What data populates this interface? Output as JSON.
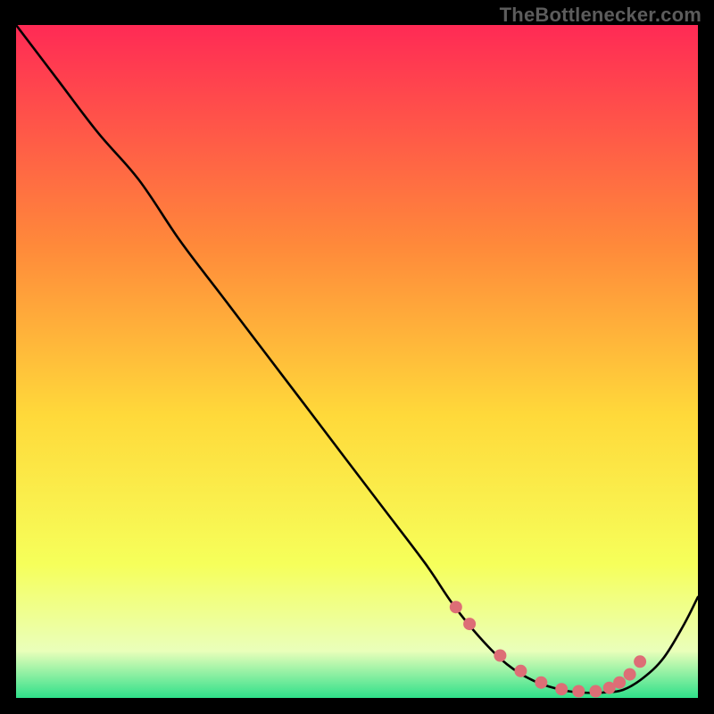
{
  "attribution": "TheBottlenecker.com",
  "colors": {
    "bg_black": "#000000",
    "line": "#000000",
    "dot_fill": "#dd6e76",
    "dot_stroke": "#dd6e76",
    "grad_top": "#ff2a55",
    "grad_mid_upper": "#ff8a3a",
    "grad_mid": "#ffd93a",
    "grad_lower": "#f6ff5a",
    "grad_pale": "#eaffba",
    "grad_green": "#2fe08a",
    "attribution_text": "#5c5c5c"
  },
  "chart_data": {
    "type": "line",
    "title": "",
    "xlabel": "",
    "ylabel": "",
    "xlim": [
      0,
      100
    ],
    "ylim": [
      0,
      100
    ],
    "grid": false,
    "legend": false,
    "series": [
      {
        "name": "bottleneck-curve",
        "x": [
          0,
          6,
          12,
          18,
          24,
          30,
          36,
          42,
          48,
          54,
          60,
          64,
          68,
          72,
          76,
          80,
          83,
          86,
          89,
          92,
          95,
          98,
          100
        ],
        "y": [
          100,
          92,
          84,
          77,
          68,
          60,
          52,
          44,
          36,
          28,
          20,
          14,
          9,
          5,
          2.5,
          1.2,
          0.8,
          0.8,
          1.2,
          3,
          6,
          11,
          15
        ]
      }
    ],
    "markers": {
      "name": "highlight-dots",
      "x": [
        64.5,
        66.5,
        71,
        74,
        77,
        80,
        82.5,
        85,
        87,
        88.5,
        90,
        91.5
      ],
      "y": [
        13.5,
        11,
        6.3,
        4,
        2.3,
        1.3,
        1.0,
        1.0,
        1.5,
        2.3,
        3.5,
        5.4
      ]
    }
  }
}
